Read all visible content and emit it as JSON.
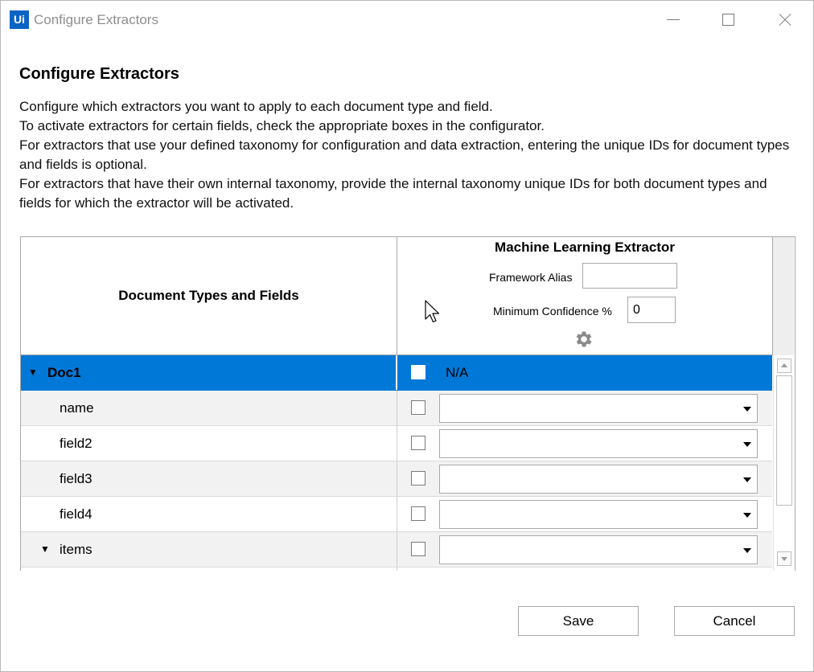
{
  "window": {
    "app_logo": "Ui",
    "title": "Configure Extractors"
  },
  "heading": "Configure Extractors",
  "description": [
    "Configure which extractors you want to apply to each document type and field.",
    "To activate extractors for certain fields, check the appropriate boxes in the configurator.",
    "For extractors that use your defined taxonomy for configuration and data extraction, entering the unique IDs for document types and fields is optional.",
    "For extractors that have their own internal taxonomy, provide the internal taxonomy unique IDs for both document types and fields for which the extractor will be activated."
  ],
  "grid": {
    "left_header": "Document Types and Fields",
    "extractor": {
      "title": "Machine Learning Extractor",
      "framework_alias_label": "Framework Alias",
      "framework_alias_value": "",
      "min_confidence_label": "Minimum Confidence %",
      "min_confidence_value": "0",
      "settings_icon": "gear-icon"
    },
    "rows": [
      {
        "name": "Doc1",
        "checked": false,
        "value": "N/A",
        "selected": true,
        "expander": "▼"
      },
      {
        "name": "name",
        "checked": false,
        "value": ""
      },
      {
        "name": "field2",
        "checked": false,
        "value": ""
      },
      {
        "name": "field3",
        "checked": false,
        "value": ""
      },
      {
        "name": "field4",
        "checked": false,
        "value": ""
      },
      {
        "name": "items",
        "checked": false,
        "value": "",
        "expander": "▼"
      }
    ]
  },
  "buttons": {
    "save": "Save",
    "cancel": "Cancel"
  },
  "colors": {
    "selection": "#0078d7",
    "logo": "#0b63c4"
  }
}
